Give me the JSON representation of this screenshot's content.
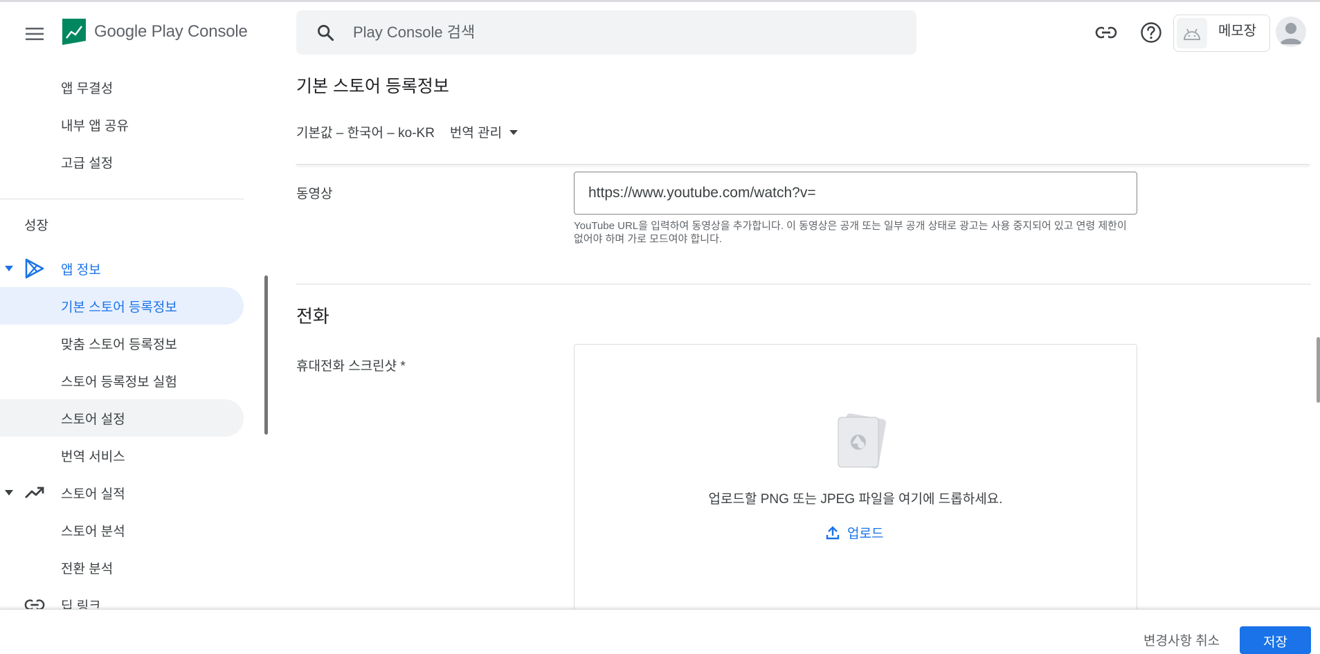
{
  "header": {
    "menu_icon": "hamburger-menu-icon",
    "logo_text": "Google Play Console",
    "search_placeholder": "Play Console 검색",
    "link_icon": "link-icon",
    "help_icon": "help-circle-icon",
    "app_name": "메모장",
    "app_icon": "android-icon",
    "avatar_icon": "account-avatar-icon"
  },
  "sidebar": {
    "top_items": [
      {
        "label": "앱 무결성"
      },
      {
        "label": "내부 앱 공유"
      },
      {
        "label": "고급 설정"
      }
    ],
    "section_heading": "성장",
    "group_app_info": {
      "label": "앱 정보",
      "icon": "play-store-icon",
      "expanded": true
    },
    "app_info_items": [
      {
        "label": "기본 스토어 등록정보",
        "active": true
      },
      {
        "label": "맞춤 스토어 등록정보"
      },
      {
        "label": "스토어 등록정보 실험"
      },
      {
        "label": "스토어 설정"
      },
      {
        "label": "번역 서비스"
      }
    ],
    "group_store_perf": {
      "label": "스토어 실적",
      "icon": "trending-up-icon",
      "expanded": true
    },
    "store_perf_items": [
      {
        "label": "스토어 분석"
      },
      {
        "label": "전환 분석"
      }
    ],
    "deep_links": {
      "label": "딥 링크",
      "icon": "link-icon"
    }
  },
  "main": {
    "page_title": "기본 스토어 등록정보",
    "language": "기본값 – 한국어 – ko-KR",
    "manage_translations": "번역 관리",
    "video": {
      "label": "동영상",
      "value": "https://www.youtube.com/watch?v=",
      "helper": "YouTube URL을 입력하여 동영상을 추가합니다. 이 동영상은 공개 또는 일부 공개 상태로 광고는 사용 중지되어 있고 연령 제한이 없어야 하며 가로 모드여야 합니다."
    },
    "section_title": "전화",
    "phone_screenshots": {
      "label": "휴대전화 스크린샷 *",
      "dropzone_text": "업로드할 PNG 또는 JPEG 파일을 여기에 드롭하세요.",
      "upload_label": "업로드"
    }
  },
  "footer": {
    "cancel_label": "변경사항 취소",
    "save_label": "저장"
  },
  "colors": {
    "accent": "#1a73e8",
    "active_bg": "#e8f0fe"
  }
}
